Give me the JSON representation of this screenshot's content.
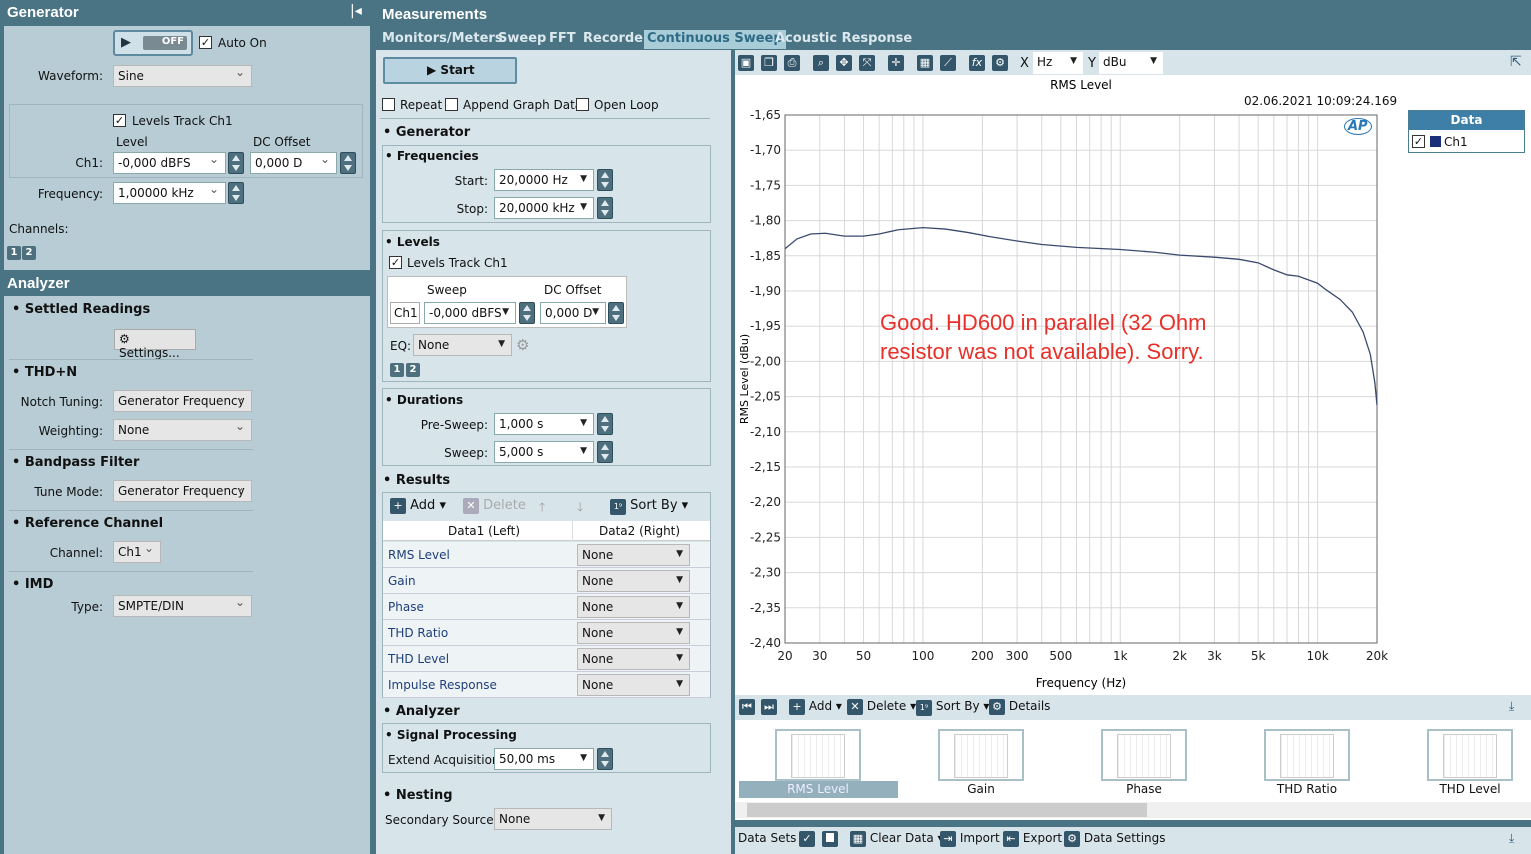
{
  "generator": {
    "title": "Generator",
    "output_state": "OFF",
    "auto_on": "Auto On",
    "waveform_label": "Waveform:",
    "waveform": "Sine",
    "levels_track": "Levels Track Ch1",
    "level_header": "Level",
    "dc_header": "DC Offset",
    "ch1_label": "Ch1:",
    "level": "-0,000 dBFS",
    "dc": "0,000 D",
    "freq_label": "Frequency:",
    "freq": "1,00000 kHz",
    "channels_label": "Channels:",
    "ch": [
      "1",
      "2"
    ]
  },
  "analyzer": {
    "title": "Analyzer",
    "settled": "Settled Readings",
    "settings": "Settings...",
    "thdn": "THD+N",
    "notch_label": "Notch Tuning:",
    "notch": "Generator Frequency",
    "weight_label": "Weighting:",
    "weight": "None",
    "bandpass": "Bandpass Filter",
    "tune_label": "Tune Mode:",
    "tune": "Generator Frequency",
    "ref": "Reference Channel",
    "channel_label": "Channel:",
    "channel": "Ch1",
    "imd": "IMD",
    "type_label": "Type:",
    "type": "SMPTE/DIN"
  },
  "measurements": {
    "title": "Measurements",
    "tabs": [
      "Monitors/Meters",
      "Sweep",
      "FFT",
      "Recorder",
      "Continuous Sweep",
      "Acoustic Response"
    ],
    "active_tab": "Continuous Sweep"
  },
  "sweep": {
    "start": "Start",
    "repeat": "Repeat",
    "append": "Append Graph Data",
    "open_loop": "Open Loop",
    "generator": "Generator",
    "frequencies": "Frequencies",
    "start_label": "Start:",
    "start_val": "20,0000 Hz",
    "stop_label": "Stop:",
    "stop_val": "20,0000 kHz",
    "levels": "Levels",
    "levels_track": "Levels Track Ch1",
    "sweep_hdr": "Sweep",
    "dc_hdr": "DC Offset",
    "ch1": "Ch1",
    "level": "-0,000 dBFS",
    "dc": "0,000 D",
    "eq_label": "EQ:",
    "eq": "None",
    "ch": [
      "1",
      "2"
    ],
    "durations": "Durations",
    "pre_label": "Pre-Sweep:",
    "pre": "1,000 s",
    "sweep_label": "Sweep:",
    "sweep_val": "5,000 s",
    "results": "Results",
    "add": "Add",
    "delete": "Delete",
    "sort": "Sort By",
    "col1": "Data1 (Left)",
    "col2": "Data2 (Right)",
    "rows": [
      {
        "name": "RMS Level",
        "val": "None"
      },
      {
        "name": "Gain",
        "val": "None"
      },
      {
        "name": "Phase",
        "val": "None"
      },
      {
        "name": "THD Ratio",
        "val": "None"
      },
      {
        "name": "THD Level",
        "val": "None"
      },
      {
        "name": "Impulse Response",
        "val": "None"
      }
    ],
    "analyzer": "Analyzer",
    "signal": "Signal Processing",
    "extend_label": "Extend Acquisition:",
    "extend": "50,00 ms",
    "nesting": "Nesting",
    "secondary_label": "Secondary Source:",
    "secondary": "None"
  },
  "graph": {
    "x_label": "X",
    "x_unit": "Hz",
    "y_label": "Y",
    "y_unit": "dBu",
    "timestamp": "02.06.2021 10:09:24.169",
    "logo": "AP",
    "annotation_line1": "Good. HD600 in parallel (32 Ohm",
    "annotation_line2": "resistor was not available). Sorry.",
    "annotation_color": "#e8302a",
    "legend_title": "Data",
    "legend_item": "Ch1",
    "series_color": "#3a4a6e"
  },
  "chart_data": {
    "type": "line",
    "title": "RMS Level",
    "xlabel": "Frequency (Hz)",
    "ylabel": "RMS Level (dBu)",
    "xscale": "log",
    "xlim": [
      20,
      20000
    ],
    "ylim": [
      -2.4,
      -1.65
    ],
    "grid": true,
    "legend": "right",
    "xticks": [
      {
        "v": 20,
        "t": "20"
      },
      {
        "v": 30,
        "t": "30"
      },
      {
        "v": 50,
        "t": "50"
      },
      {
        "v": 100,
        "t": "100"
      },
      {
        "v": 200,
        "t": "200"
      },
      {
        "v": 300,
        "t": "300"
      },
      {
        "v": 500,
        "t": "500"
      },
      {
        "v": 1000,
        "t": "1k"
      },
      {
        "v": 2000,
        "t": "2k"
      },
      {
        "v": 3000,
        "t": "3k"
      },
      {
        "v": 5000,
        "t": "5k"
      },
      {
        "v": 10000,
        "t": "10k"
      },
      {
        "v": 20000,
        "t": "20k"
      }
    ],
    "yticks": [
      "-1,65",
      "-1,70",
      "-1,75",
      "-1,80",
      "-1,85",
      "-1,90",
      "-1,95",
      "-2,00",
      "-2,05",
      "-2,10",
      "-2,15",
      "-2,20",
      "-2,25",
      "-2,30",
      "-2,35",
      "-2,40"
    ],
    "series": [
      {
        "name": "Ch1",
        "x": [
          20,
          23,
          27,
          32,
          40,
          50,
          60,
          75,
          100,
          130,
          170,
          220,
          300,
          400,
          600,
          1000,
          1500,
          2000,
          3000,
          4000,
          5000,
          6000,
          7000,
          8000,
          10000,
          11000,
          13000,
          15000,
          17000,
          18500,
          19500,
          20000
        ],
        "y": [
          -1.84,
          -1.826,
          -1.819,
          -1.818,
          -1.822,
          -1.822,
          -1.819,
          -1.813,
          -1.81,
          -1.812,
          -1.817,
          -1.823,
          -1.829,
          -1.834,
          -1.838,
          -1.841,
          -1.845,
          -1.849,
          -1.852,
          -1.855,
          -1.86,
          -1.87,
          -1.877,
          -1.879,
          -1.889,
          -1.898,
          -1.912,
          -1.93,
          -1.958,
          -1.99,
          -2.03,
          -2.062
        ]
      }
    ]
  },
  "pages": {
    "nav": [
      "Add",
      "Delete",
      "Sort By",
      "Details"
    ],
    "thumbs": [
      "RMS Level",
      "Gain",
      "Phase",
      "THD Ratio",
      "THD Level"
    ],
    "active": "RMS Level"
  },
  "datasets": {
    "label": "Data Sets",
    "clear": "Clear Data",
    "import": "Import",
    "export": "Export",
    "settings": "Data Settings"
  }
}
